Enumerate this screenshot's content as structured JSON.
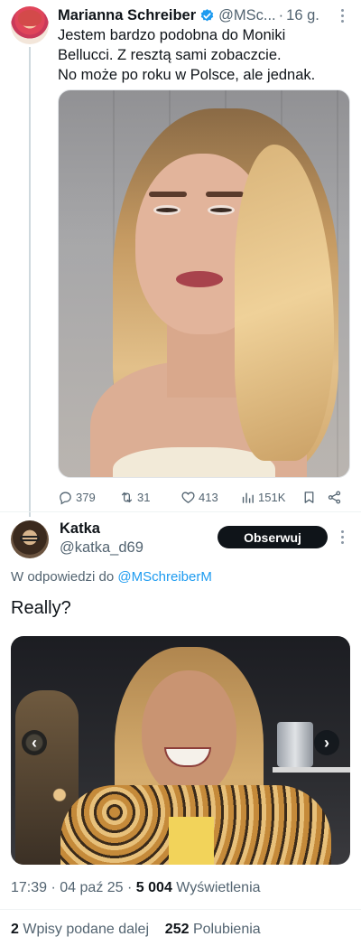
{
  "tweet1": {
    "name": "Marianna Schreiber",
    "handle": "@MSc...",
    "time": "16 g.",
    "text_lines": [
      "Jestem bardzo podobna do Moniki",
      "Bellucci. Z resztą sami zobaczcie.",
      "No może po roku w Polsce, ale jednak."
    ],
    "actions": {
      "replies": "379",
      "reposts": "31",
      "likes": "413",
      "views": "151K"
    }
  },
  "tweet2": {
    "name": "Katka",
    "handle": "@katka_d69",
    "follow_label": "Obserwuj",
    "reply_prefix": "W odpowiedzi do",
    "reply_mention": "@MSchreiberM",
    "text": "Really?",
    "meta": {
      "time": "17:39",
      "date": "04 paź 25",
      "views_count": "5 004",
      "views_label": "Wyświetlenia"
    },
    "stats": {
      "reposts_count": "2",
      "reposts_label": "Wpisy podane dalej",
      "likes_count": "252",
      "likes_label": "Polubienia"
    }
  },
  "colors": {
    "accent": "#1d9bf0",
    "text": "#0f1419",
    "muted": "#536471",
    "follow_button": "#0f1419"
  }
}
